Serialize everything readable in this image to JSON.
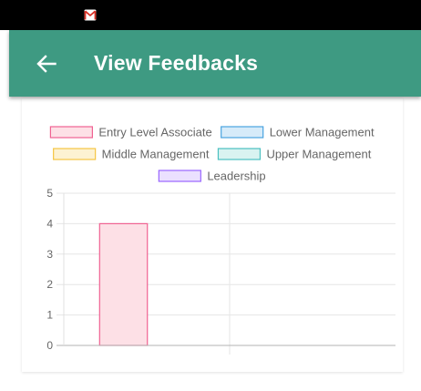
{
  "header": {
    "title": "View Feedbacks",
    "back_icon": "arrow-left-icon",
    "color": "#3e9a82"
  },
  "status_bar": {
    "notification_icon": "gmail-icon"
  },
  "chart_data": {
    "type": "bar",
    "categories": [
      ""
    ],
    "series": [
      {
        "name": "Entry Level Associate",
        "values": [
          4
        ],
        "border": "#f06292",
        "fill": "#fde0e6"
      },
      {
        "name": "Lower Management",
        "values": [
          0
        ],
        "border": "#4aa3df",
        "fill": "#d6ebf9"
      },
      {
        "name": "Middle Management",
        "values": [
          0
        ],
        "border": "#f5c542",
        "fill": "#fdf2d2"
      },
      {
        "name": "Upper Management",
        "values": [
          0
        ],
        "border": "#4bc0c0",
        "fill": "#d9f3f1"
      },
      {
        "name": "Leadership",
        "values": [
          0
        ],
        "border": "#9966ff",
        "fill": "#ebe0ff"
      }
    ],
    "y_ticks": [
      "0",
      "1",
      "2",
      "3",
      "4",
      "5"
    ],
    "ylim": [
      0,
      5
    ],
    "grid": true,
    "legend": "top",
    "title": "",
    "xlabel": "",
    "ylabel": ""
  }
}
